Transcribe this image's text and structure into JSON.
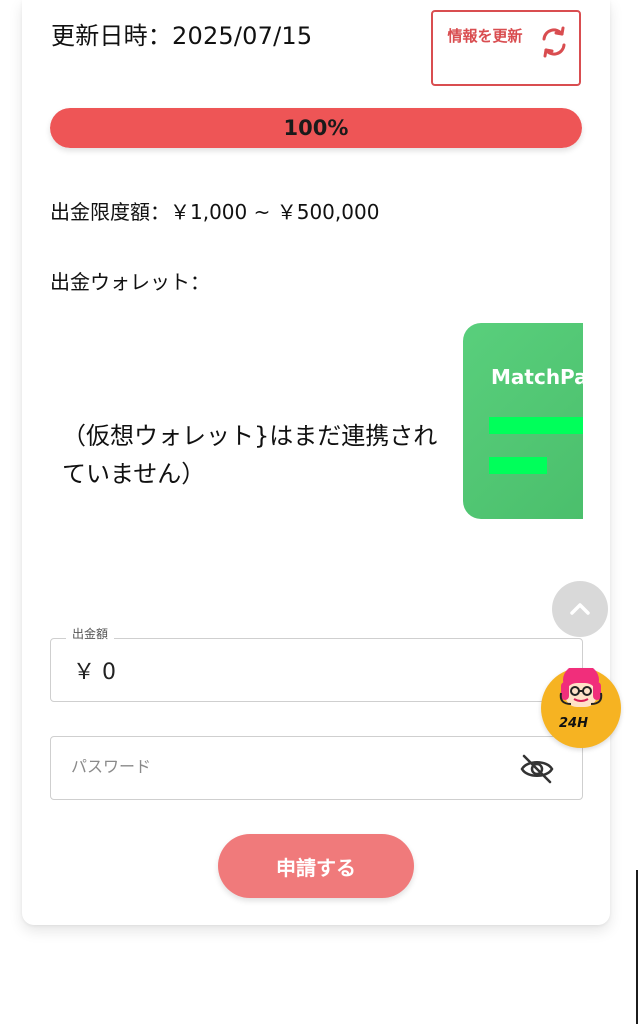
{
  "header": {
    "update_time": "更新日時：2025/07/15",
    "refresh_label": "情報を更新"
  },
  "progress": {
    "value": 100,
    "label": "100%"
  },
  "withdrawal": {
    "limit_text": "出金限度額：￥1,000 ~ ￥500,000",
    "wallet_label": "出金ウォレット：",
    "wallet_message": "（仮想ウォレット}はまだ連携されていません）",
    "wallet_card_name": "MatchPa"
  },
  "form": {
    "amount_label": "出金額",
    "amount_value": "￥ 0",
    "password_placeholder": "パスワード",
    "submit_label": "申請する"
  },
  "support": {
    "badge": "24H"
  },
  "colors": {
    "accent_red": "#ee5556",
    "submit_pink": "#f07a7b",
    "wallet_green": "#59cf7c",
    "support_yellow": "#f6b322"
  },
  "icons": {
    "refresh": "refresh-icon",
    "scroll_top": "chevron-up-icon",
    "password_visibility": "eye-off-icon",
    "support": "support-avatar-icon"
  }
}
